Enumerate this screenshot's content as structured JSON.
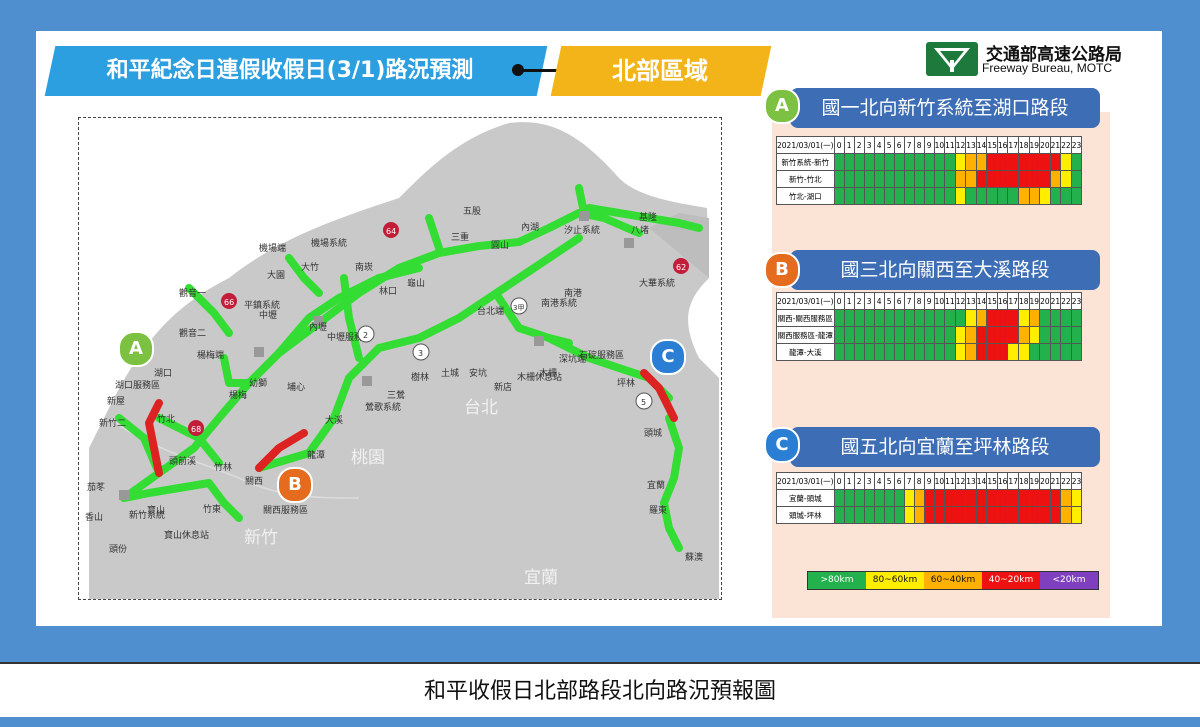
{
  "title": "和平紀念日連假收假日(3/1)路況預測",
  "region": "北部區域",
  "org": {
    "name_cn": "交通部高速公路局",
    "name_en": "Freeway Bureau, MOTC"
  },
  "caption": "和平收假日北部路段北向路況預報圖",
  "colors": {
    "green": "#22b14c",
    "yellow": "#ffee00",
    "orange": "#ffb100",
    "red": "#ee1111",
    "purple": "#7f3fbf",
    "route_green": "#33dd33",
    "route_red": "#dd2222",
    "badge_a": "#7cc142",
    "badge_b": "#e56b1f",
    "badge_c": "#2a7fd4"
  },
  "hour_header_date": "2021/03/01(一)",
  "hours": [
    "0",
    "1",
    "2",
    "3",
    "4",
    "5",
    "6",
    "7",
    "8",
    "9",
    "10",
    "11",
    "12",
    "13",
    "14",
    "15",
    "16",
    "17",
    "18",
    "19",
    "20",
    "21",
    "22",
    "23"
  ],
  "sections": [
    {
      "badge": "A",
      "title": "國一北向新竹系統至湖口路段",
      "rows": [
        {
          "label": "新竹系統-新竹",
          "cells": "GGGGGGGGGGGGGGYOORRRRRRRYGGG"
        },
        {
          "label": "新竹-竹北",
          "cells": "GGGGGGGGGGGGGGOORRRRRRROYGGG"
        },
        {
          "label": "竹北-湖口",
          "cells": "GGGGGGGGGGGGGGYGGGGGOOYGGGGG"
        }
      ]
    },
    {
      "badge": "B",
      "title": "國三北向關西至大溪路段",
      "rows": [
        {
          "label": "關西-關西服務區",
          "cells": "GGGGGGGGGGGGGGGYORRRYOGGGGGG"
        },
        {
          "label": "關西服務區-龍潭",
          "cells": "GGGGGGGGGGGGGGYORRRROYGGGGGG"
        },
        {
          "label": "龍潭-大溪",
          "cells": "GGGGGGGGGGGGGGYORRRYYGGGGGGG"
        }
      ]
    },
    {
      "badge": "C",
      "title": "國五北向宜蘭至坪林路段",
      "rows": [
        {
          "label": "宜蘭-頭城",
          "cells": "GGGGGGGGGYORRRRRRRRRRRRROYGG"
        },
        {
          "label": "頭城-坪林",
          "cells": "GGGGGGGGGYORRRRRRRRRRRRROYGG"
        }
      ]
    }
  ],
  "legend": [
    {
      "label": ">80km",
      "color": "#22b14c"
    },
    {
      "label": "80~60km",
      "color": "#ffee00"
    },
    {
      "label": "60~40km",
      "color": "#ffb100"
    },
    {
      "label": "40~20km",
      "color": "#ee1111"
    },
    {
      "label": "<20km",
      "color": "#7f3fbf"
    }
  ],
  "map": {
    "area_labels": [
      "台北",
      "桃園",
      "新竹",
      "宜蘭"
    ],
    "badges": [
      "A",
      "B",
      "C"
    ],
    "places": [
      "機場端",
      "機場系統",
      "大竹",
      "大園",
      "觀音一",
      "觀音二",
      "楊梅端",
      "湖口",
      "湖口服務區",
      "新竹二",
      "竹北",
      "頭前溪",
      "竹林",
      "茄苳",
      "香山",
      "頭份",
      "寶山休息站",
      "新竹系統",
      "寶山",
      "竹東",
      "關西",
      "關西服務區",
      "龍潭",
      "大溪",
      "鶯歌系統",
      "三鶯",
      "樹林",
      "土城",
      "安坑",
      "新店",
      "木柵休息站",
      "木柵",
      "深坑端",
      "石碇服務區",
      "坪林",
      "頭城",
      "宜蘭",
      "羅東",
      "蘇澳",
      "汐止系統",
      "八堵",
      "基隆",
      "大華系統",
      "南港系統",
      "台北端",
      "五股",
      "三重",
      "內湖",
      "南港",
      "圓山",
      "林口",
      "中壢",
      "內壢",
      "平鎮系統",
      "幼獅",
      "中壢服務區",
      "南崁",
      "龜山",
      "新屋",
      "楊梅",
      "埔心"
    ]
  }
}
